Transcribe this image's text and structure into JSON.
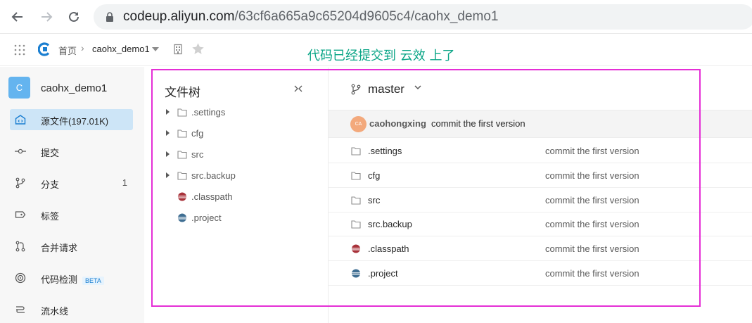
{
  "browser": {
    "url_host": "codeup.aliyun.com",
    "url_path": "/63cf6a665a9c65204d9605c4/caohx_demo1"
  },
  "header": {
    "breadcrumb_home": "首页",
    "breadcrumb_sep": "›",
    "repo": "caohx_demo1"
  },
  "annotation": "代码已经提交到 云效 上了",
  "sidebar": {
    "avatar_letter": "C",
    "repo_name": "caohx_demo1",
    "items": [
      {
        "label": "源文件(197.01K)",
        "icon": "source-files-icon"
      },
      {
        "label": "提交",
        "icon": "commit-icon"
      },
      {
        "label": "分支",
        "icon": "branch-icon",
        "count": "1"
      },
      {
        "label": "标签",
        "icon": "tag-icon"
      },
      {
        "label": "合并请求",
        "icon": "merge-request-icon"
      },
      {
        "label": "代码检测",
        "icon": "code-scan-icon",
        "badge": "BETA"
      },
      {
        "label": "流水线",
        "icon": "pipeline-icon"
      }
    ]
  },
  "tree": {
    "title": "文件树",
    "items": [
      {
        "label": ".settings",
        "type": "folder"
      },
      {
        "label": "cfg",
        "type": "folder"
      },
      {
        "label": "src",
        "type": "folder"
      },
      {
        "label": "src.backup",
        "type": "folder"
      },
      {
        "label": ".classpath",
        "type": "eclipse-file"
      },
      {
        "label": ".project",
        "type": "eclipse-project-file"
      }
    ]
  },
  "files": {
    "branch": "master",
    "commit": {
      "avatar_text": "CA",
      "author": "caohongxing",
      "message": "commit the first version"
    },
    "rows": [
      {
        "name": ".settings",
        "type": "folder",
        "message": "commit the first version"
      },
      {
        "name": "cfg",
        "type": "folder",
        "message": "commit the first version"
      },
      {
        "name": "src",
        "type": "folder",
        "message": "commit the first version"
      },
      {
        "name": "src.backup",
        "type": "folder",
        "message": "commit the first version"
      },
      {
        "name": ".classpath",
        "type": "eclipse-file",
        "message": "commit the first version"
      },
      {
        "name": ".project",
        "type": "eclipse-project-file",
        "message": "commit the first version"
      }
    ]
  },
  "colors": {
    "annotation": "#0aa586",
    "highlight": "#e52fd6",
    "active_nav": "#cde5f7"
  }
}
